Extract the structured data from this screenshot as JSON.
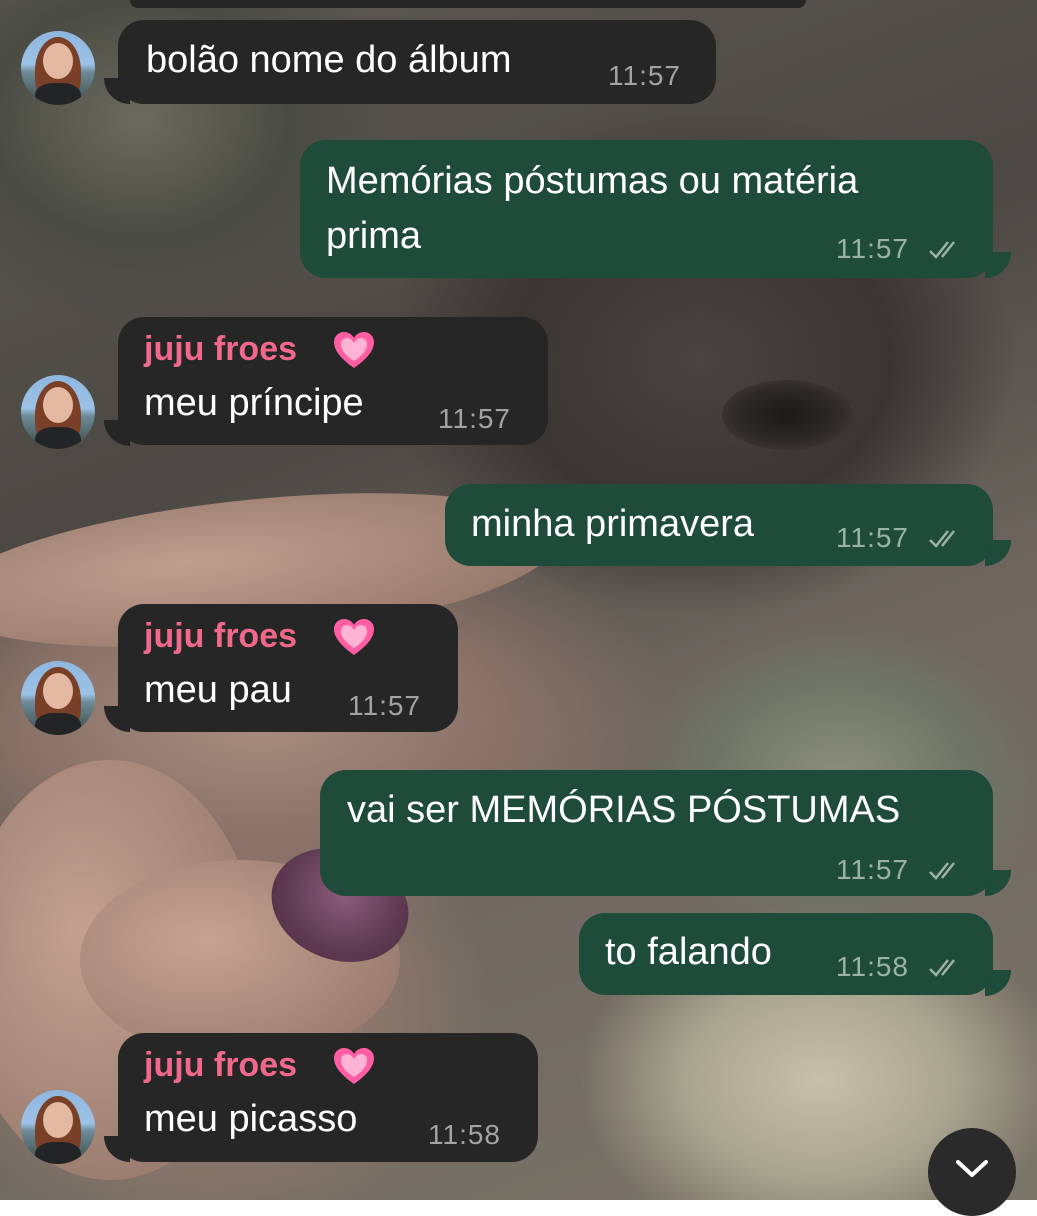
{
  "messages": [
    {
      "direction": "in",
      "text": "bolão nome do álbum",
      "time": "11:57"
    },
    {
      "direction": "out",
      "line1": "Memórias póstumas ou matéria",
      "line2": "prima",
      "time": "11:57"
    },
    {
      "direction": "in",
      "sender": "juju froes",
      "text": "meu príncipe",
      "time": "11:57"
    },
    {
      "direction": "out",
      "text": "minha primavera",
      "time": "11:57"
    },
    {
      "direction": "in",
      "sender": "juju froes",
      "text": "meu pau",
      "time": "11:57"
    },
    {
      "direction": "out",
      "text": "vai ser MEMÓRIAS PÓSTUMAS",
      "time": "11:57"
    },
    {
      "direction": "out",
      "text": "to falando",
      "time": "11:58"
    },
    {
      "direction": "in",
      "sender": "juju froes",
      "text": "meu picasso",
      "time": "11:58"
    }
  ],
  "icons": {
    "sender_badge": "sparkling-heart-icon",
    "read_receipt": "double-check-icon",
    "scroll_down": "chevron-down-icon"
  },
  "colors": {
    "incoming_bubble": "#262626",
    "outgoing_bubble": "#1f4b3a",
    "sender_name": "#f0688a",
    "timestamp": "#a3a3a3"
  }
}
